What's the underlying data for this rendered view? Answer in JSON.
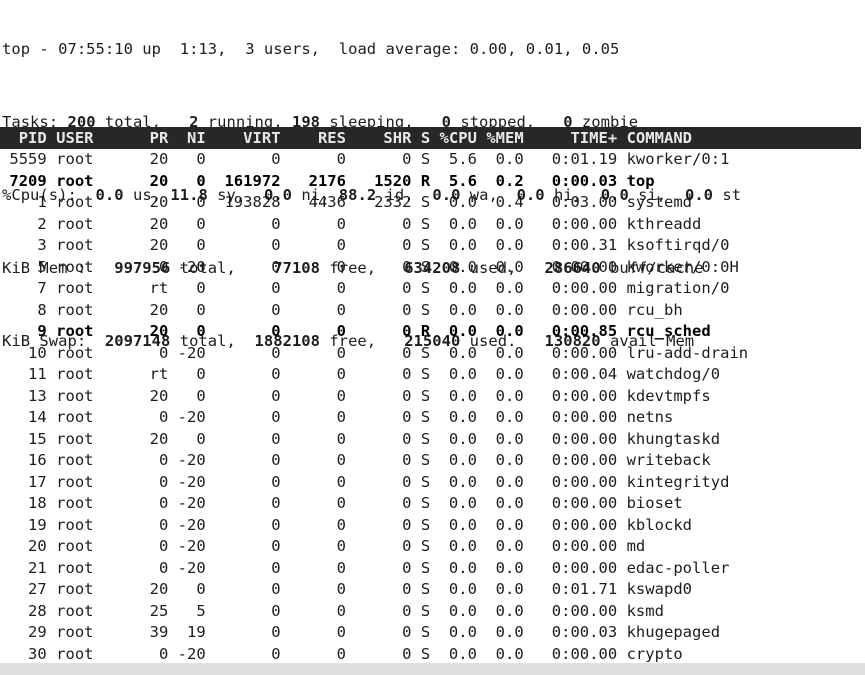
{
  "summary": {
    "uptime_line": {
      "prefix": "top - ",
      "time": "07:55:10",
      "up_label": " up ",
      "uptime": " 1:13,",
      "users": "  3 users,",
      "load_label": "  load average: ",
      "load": "0.00, 0.01, 0.05"
    },
    "tasks_line": {
      "label": "Tasks:",
      "total": "200",
      "total_label": " total,",
      "running": "2",
      "running_label": " running,",
      "sleeping": "198",
      "sleeping_label": " sleeping,",
      "stopped": "0",
      "stopped_label": " stopped,",
      "zombie": "0",
      "zombie_label": " zombie"
    },
    "cpu_line": {
      "label": "%Cpu(s):",
      "us": "0.0",
      "us_label": " us,",
      "sy": "11.8",
      "sy_label": " sy,",
      "ni": "0.0",
      "ni_label": " ni,",
      "id": "88.2",
      "id_label": " id,",
      "wa": "0.0",
      "wa_label": " wa,",
      "hi": "0.0",
      "hi_label": " hi,",
      "si": "0.0",
      "si_label": " si,",
      "st": "0.0",
      "st_label": " st"
    },
    "mem_line": {
      "label": "KiB Mem :",
      "total": "997956",
      "total_label": " total,",
      "free": "77108",
      "free_label": " free,",
      "used": "634208",
      "used_label": " used,",
      "buffcache": "286640",
      "buffcache_label": " buff/cache"
    },
    "swap_line": {
      "label": "KiB Swap:",
      "total": "2097148",
      "total_label": " total,",
      "free": "1882108",
      "free_label": " free,",
      "used": "215040",
      "used_label": " used.",
      "avail": "130820",
      "avail_label": " avail Mem"
    }
  },
  "table": {
    "headers": [
      "PID",
      "USER",
      "PR",
      "NI",
      "VIRT",
      "RES",
      "SHR",
      "S",
      "%CPU",
      "%MEM",
      "TIME+",
      "COMMAND"
    ],
    "header_line": "  PID USER      PR  NI    VIRT    RES    SHR S %CPU %MEM     TIME+ COMMAND",
    "rows": [
      {
        "pid": "5559",
        "user": "root",
        "pr": "20",
        "ni": "0",
        "virt": "0",
        "res": "0",
        "shr": "0",
        "s": "S",
        "cpu": "5.6",
        "mem": "0.0",
        "time": "0:01.19",
        "command": "kworker/0:1",
        "bold": false
      },
      {
        "pid": "7209",
        "user": "root",
        "pr": "20",
        "ni": "0",
        "virt": "161972",
        "res": "2176",
        "shr": "1520",
        "s": "R",
        "cpu": "5.6",
        "mem": "0.2",
        "time": "0:00.03",
        "command": "top",
        "bold": true
      },
      {
        "pid": "1",
        "user": "root",
        "pr": "20",
        "ni": "0",
        "virt": "193828",
        "res": "4436",
        "shr": "2332",
        "s": "S",
        "cpu": "0.0",
        "mem": "0.4",
        "time": "0:03.00",
        "command": "systemd",
        "bold": false
      },
      {
        "pid": "2",
        "user": "root",
        "pr": "20",
        "ni": "0",
        "virt": "0",
        "res": "0",
        "shr": "0",
        "s": "S",
        "cpu": "0.0",
        "mem": "0.0",
        "time": "0:00.00",
        "command": "kthreadd",
        "bold": false
      },
      {
        "pid": "3",
        "user": "root",
        "pr": "20",
        "ni": "0",
        "virt": "0",
        "res": "0",
        "shr": "0",
        "s": "S",
        "cpu": "0.0",
        "mem": "0.0",
        "time": "0:00.31",
        "command": "ksoftirqd/0",
        "bold": false
      },
      {
        "pid": "5",
        "user": "root",
        "pr": "0",
        "ni": "-20",
        "virt": "0",
        "res": "0",
        "shr": "0",
        "s": "S",
        "cpu": "0.0",
        "mem": "0.0",
        "time": "0:00.00",
        "command": "kworker/0:0H",
        "bold": false
      },
      {
        "pid": "7",
        "user": "root",
        "pr": "rt",
        "ni": "0",
        "virt": "0",
        "res": "0",
        "shr": "0",
        "s": "S",
        "cpu": "0.0",
        "mem": "0.0",
        "time": "0:00.00",
        "command": "migration/0",
        "bold": false
      },
      {
        "pid": "8",
        "user": "root",
        "pr": "20",
        "ni": "0",
        "virt": "0",
        "res": "0",
        "shr": "0",
        "s": "S",
        "cpu": "0.0",
        "mem": "0.0",
        "time": "0:00.00",
        "command": "rcu_bh",
        "bold": false
      },
      {
        "pid": "9",
        "user": "root",
        "pr": "20",
        "ni": "0",
        "virt": "0",
        "res": "0",
        "shr": "0",
        "s": "R",
        "cpu": "0.0",
        "mem": "0.0",
        "time": "0:00.85",
        "command": "rcu_sched",
        "bold": true
      },
      {
        "pid": "10",
        "user": "root",
        "pr": "0",
        "ni": "-20",
        "virt": "0",
        "res": "0",
        "shr": "0",
        "s": "S",
        "cpu": "0.0",
        "mem": "0.0",
        "time": "0:00.00",
        "command": "lru-add-drain",
        "bold": false
      },
      {
        "pid": "11",
        "user": "root",
        "pr": "rt",
        "ni": "0",
        "virt": "0",
        "res": "0",
        "shr": "0",
        "s": "S",
        "cpu": "0.0",
        "mem": "0.0",
        "time": "0:00.04",
        "command": "watchdog/0",
        "bold": false
      },
      {
        "pid": "13",
        "user": "root",
        "pr": "20",
        "ni": "0",
        "virt": "0",
        "res": "0",
        "shr": "0",
        "s": "S",
        "cpu": "0.0",
        "mem": "0.0",
        "time": "0:00.00",
        "command": "kdevtmpfs",
        "bold": false
      },
      {
        "pid": "14",
        "user": "root",
        "pr": "0",
        "ni": "-20",
        "virt": "0",
        "res": "0",
        "shr": "0",
        "s": "S",
        "cpu": "0.0",
        "mem": "0.0",
        "time": "0:00.00",
        "command": "netns",
        "bold": false
      },
      {
        "pid": "15",
        "user": "root",
        "pr": "20",
        "ni": "0",
        "virt": "0",
        "res": "0",
        "shr": "0",
        "s": "S",
        "cpu": "0.0",
        "mem": "0.0",
        "time": "0:00.00",
        "command": "khungtaskd",
        "bold": false
      },
      {
        "pid": "16",
        "user": "root",
        "pr": "0",
        "ni": "-20",
        "virt": "0",
        "res": "0",
        "shr": "0",
        "s": "S",
        "cpu": "0.0",
        "mem": "0.0",
        "time": "0:00.00",
        "command": "writeback",
        "bold": false
      },
      {
        "pid": "17",
        "user": "root",
        "pr": "0",
        "ni": "-20",
        "virt": "0",
        "res": "0",
        "shr": "0",
        "s": "S",
        "cpu": "0.0",
        "mem": "0.0",
        "time": "0:00.00",
        "command": "kintegrityd",
        "bold": false
      },
      {
        "pid": "18",
        "user": "root",
        "pr": "0",
        "ni": "-20",
        "virt": "0",
        "res": "0",
        "shr": "0",
        "s": "S",
        "cpu": "0.0",
        "mem": "0.0",
        "time": "0:00.00",
        "command": "bioset",
        "bold": false
      },
      {
        "pid": "19",
        "user": "root",
        "pr": "0",
        "ni": "-20",
        "virt": "0",
        "res": "0",
        "shr": "0",
        "s": "S",
        "cpu": "0.0",
        "mem": "0.0",
        "time": "0:00.00",
        "command": "kblockd",
        "bold": false
      },
      {
        "pid": "20",
        "user": "root",
        "pr": "0",
        "ni": "-20",
        "virt": "0",
        "res": "0",
        "shr": "0",
        "s": "S",
        "cpu": "0.0",
        "mem": "0.0",
        "time": "0:00.00",
        "command": "md",
        "bold": false
      },
      {
        "pid": "21",
        "user": "root",
        "pr": "0",
        "ni": "-20",
        "virt": "0",
        "res": "0",
        "shr": "0",
        "s": "S",
        "cpu": "0.0",
        "mem": "0.0",
        "time": "0:00.00",
        "command": "edac-poller",
        "bold": false
      },
      {
        "pid": "27",
        "user": "root",
        "pr": "20",
        "ni": "0",
        "virt": "0",
        "res": "0",
        "shr": "0",
        "s": "S",
        "cpu": "0.0",
        "mem": "0.0",
        "time": "0:01.71",
        "command": "kswapd0",
        "bold": false
      },
      {
        "pid": "28",
        "user": "root",
        "pr": "25",
        "ni": "5",
        "virt": "0",
        "res": "0",
        "shr": "0",
        "s": "S",
        "cpu": "0.0",
        "mem": "0.0",
        "time": "0:00.00",
        "command": "ksmd",
        "bold": false
      },
      {
        "pid": "29",
        "user": "root",
        "pr": "39",
        "ni": "19",
        "virt": "0",
        "res": "0",
        "shr": "0",
        "s": "S",
        "cpu": "0.0",
        "mem": "0.0",
        "time": "0:00.03",
        "command": "khugepaged",
        "bold": false
      },
      {
        "pid": "30",
        "user": "root",
        "pr": "0",
        "ni": "-20",
        "virt": "0",
        "res": "0",
        "shr": "0",
        "s": "S",
        "cpu": "0.0",
        "mem": "0.0",
        "time": "0:00.00",
        "command": "crypto",
        "bold": false
      }
    ]
  },
  "colors": {
    "header_bg": "#272727",
    "header_fg": "#e8e8e8",
    "text": "#1d1d1d",
    "background": "#ffffff",
    "footer_bar": "#e0e0e0"
  }
}
